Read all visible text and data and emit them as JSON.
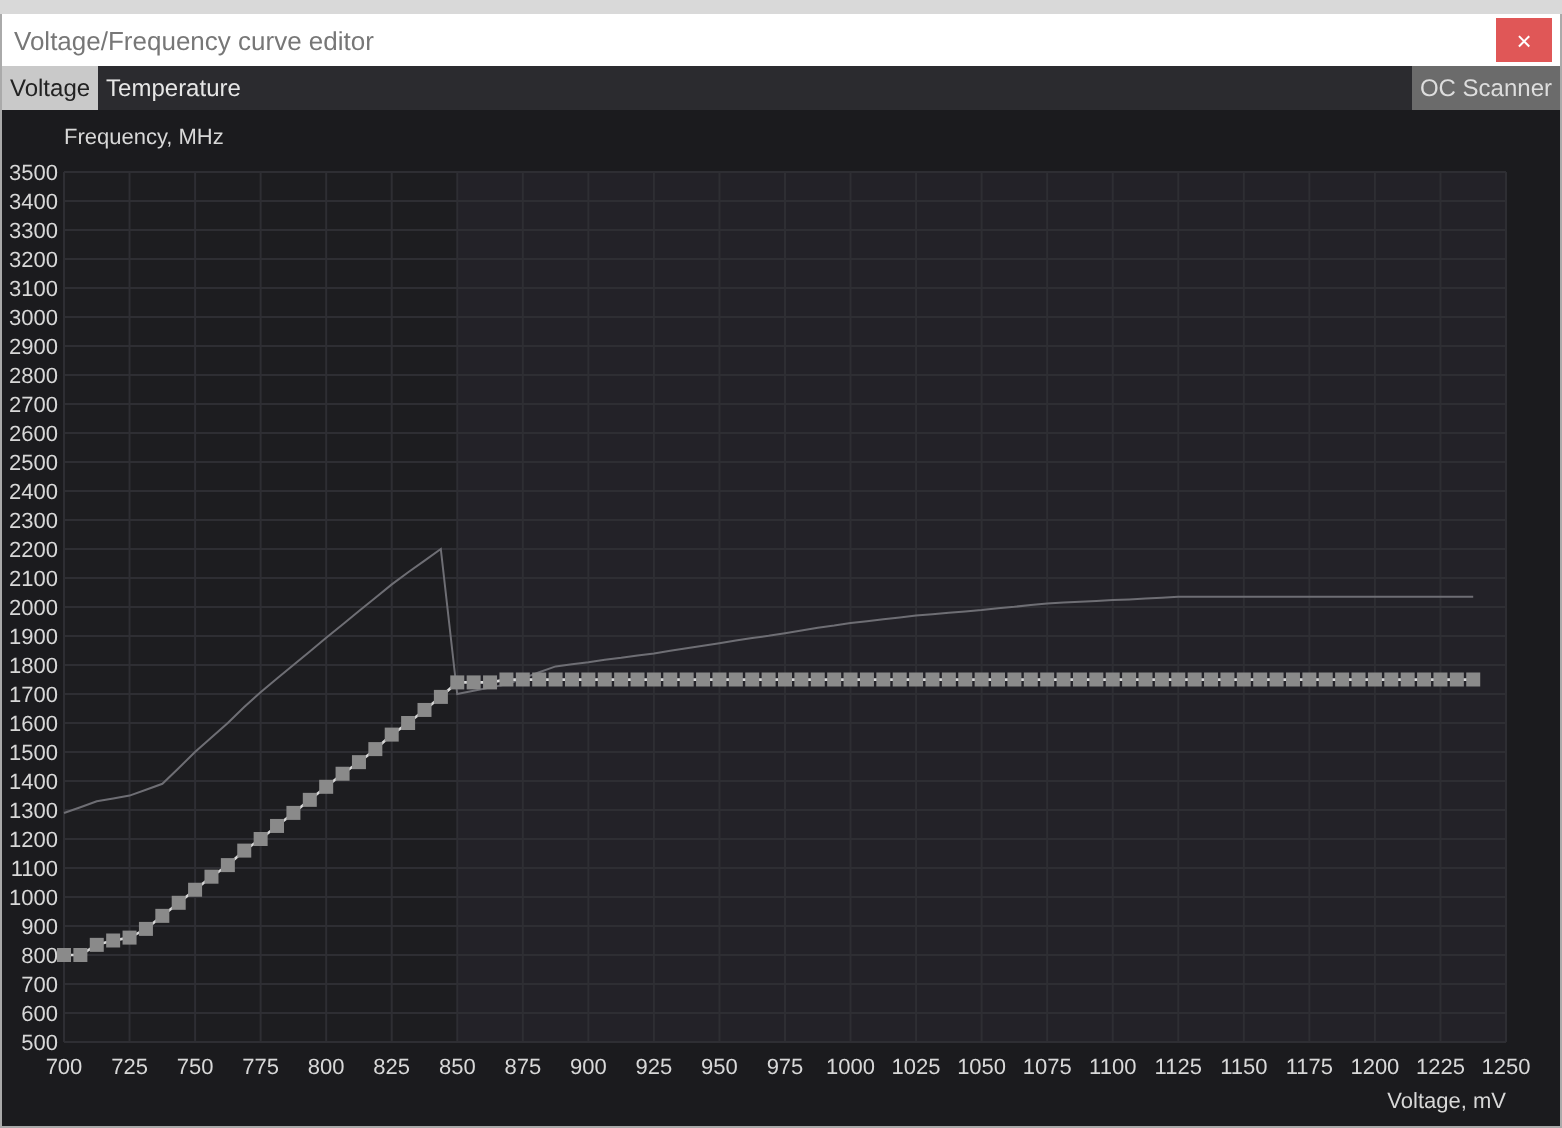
{
  "window": {
    "title": "Voltage/Frequency curve editor",
    "close_label": "×"
  },
  "tabs": [
    {
      "label": "Voltage",
      "selected": true
    },
    {
      "label": "Temperature",
      "selected": false
    }
  ],
  "oc_scanner": {
    "label": "OC Scanner"
  },
  "chart": {
    "chart_data": {
      "type": "line",
      "grid": true,
      "xlabel": "Voltage, mV",
      "ylabel": "Frequency, MHz",
      "xlim": [
        700,
        1250
      ],
      "ylim": [
        500,
        3500
      ],
      "xticks": [
        700,
        725,
        750,
        775,
        800,
        825,
        850,
        875,
        900,
        925,
        950,
        975,
        1000,
        1025,
        1050,
        1075,
        1100,
        1125,
        1150,
        1175,
        1200,
        1225,
        1250
      ],
      "yticks": [
        500,
        600,
        700,
        800,
        900,
        1000,
        1100,
        1200,
        1300,
        1400,
        1500,
        1600,
        1700,
        1800,
        1900,
        2000,
        2100,
        2200,
        2300,
        2400,
        2500,
        2600,
        2700,
        2800,
        2900,
        3000,
        3100,
        3200,
        3300,
        3400,
        3500
      ],
      "x": [
        700,
        706.25,
        712.5,
        718.75,
        725,
        731.25,
        737.5,
        743.75,
        750,
        756.25,
        762.5,
        768.75,
        775,
        781.25,
        787.5,
        793.75,
        800,
        806.25,
        812.5,
        818.75,
        825,
        831.25,
        837.5,
        843.75,
        850,
        856.25,
        862.5,
        868.75,
        875,
        881.25,
        887.5,
        893.75,
        900,
        906.25,
        912.5,
        918.75,
        925,
        931.25,
        937.5,
        943.75,
        950,
        956.25,
        962.5,
        968.75,
        975,
        981.25,
        987.5,
        993.75,
        1000,
        1006.25,
        1012.5,
        1018.75,
        1025,
        1031.25,
        1037.5,
        1043.75,
        1050,
        1056.25,
        1062.5,
        1068.75,
        1075,
        1081.25,
        1087.5,
        1093.75,
        1100,
        1106.25,
        1112.5,
        1118.75,
        1125,
        1131.25,
        1137.5,
        1143.75,
        1150,
        1156.25,
        1162.5,
        1168.75,
        1175,
        1181.25,
        1187.5,
        1193.75,
        1200,
        1206.25,
        1212.5,
        1218.75,
        1225,
        1231.25,
        1237.5
      ],
      "series": [
        {
          "color": "#6e6e74",
          "values": [
            1290,
            1310,
            1330,
            1340,
            1350,
            1370,
            1390,
            1445,
            1500,
            1550,
            1600,
            1655,
            1706,
            1753,
            1800,
            1847,
            1894,
            1940,
            1986,
            2032,
            2078,
            2120,
            2160,
            2200,
            1700,
            1711,
            1722,
            1733,
            1754,
            1775,
            1795,
            1803,
            1810,
            1818,
            1825,
            1833,
            1840,
            1849,
            1858,
            1866,
            1875,
            1884,
            1893,
            1901,
            1910,
            1919,
            1928,
            1936,
            1945,
            1951,
            1958,
            1964,
            1970,
            1975,
            1980,
            1985,
            1990,
            1996,
            2001,
            2007,
            2012,
            2015,
            2018,
            2021,
            2024,
            2026,
            2029,
            2032,
            2035,
            2035,
            2035,
            2035,
            2035,
            2035,
            2035,
            2035,
            2035,
            2035,
            2035,
            2035,
            2035,
            2035,
            2035,
            2035,
            2035,
            2035,
            2035
          ]
        },
        {
          "color": "#d8d8d8",
          "marker": "square",
          "values": [
            800,
            800,
            835,
            850,
            860,
            890,
            935,
            980,
            1025,
            1070,
            1110,
            1160,
            1200,
            1245,
            1290,
            1335,
            1380,
            1425,
            1465,
            1510,
            1560,
            1600,
            1645,
            1690,
            1740,
            1740,
            1740,
            1750,
            1750,
            1750,
            1750,
            1750,
            1750,
            1750,
            1750,
            1750,
            1750,
            1750,
            1750,
            1750,
            1750,
            1750,
            1750,
            1750,
            1750,
            1750,
            1750,
            1750,
            1750,
            1750,
            1750,
            1750,
            1750,
            1750,
            1750,
            1750,
            1750,
            1750,
            1750,
            1750,
            1750,
            1750,
            1750,
            1750,
            1750,
            1750,
            1750,
            1750,
            1750,
            1750,
            1750,
            1750,
            1750,
            1750,
            1750,
            1750,
            1750,
            1750,
            1750,
            1750,
            1750,
            1750,
            1750,
            1750,
            1750,
            1750,
            1750
          ]
        }
      ]
    }
  }
}
